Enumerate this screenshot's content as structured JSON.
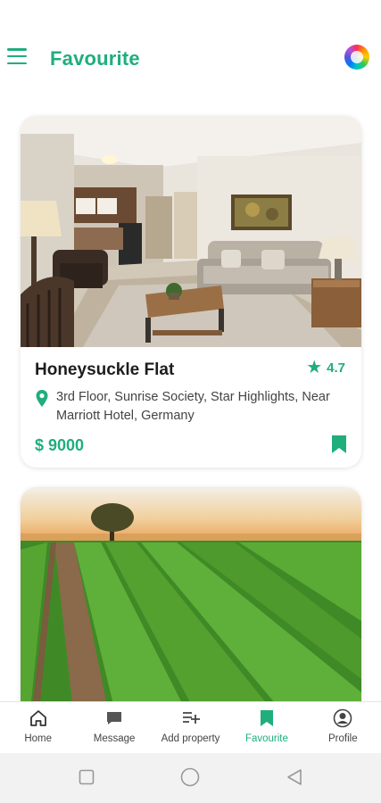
{
  "header": {
    "title": "Favourite"
  },
  "properties": [
    {
      "name": "Honeysuckle Flat",
      "rating": "4.7",
      "address": "3rd Floor, Sunrise Society, Star Highlights, Near Marriott Hotel, Germany",
      "price": "$ 9000",
      "image": "living-room-photo"
    },
    {
      "image": "farm-field-photo"
    }
  ],
  "bottom_nav": {
    "items": [
      {
        "label": "Home",
        "icon": "home-icon"
      },
      {
        "label": "Message",
        "icon": "message-icon"
      },
      {
        "label": "Add property",
        "icon": "add-property-icon"
      },
      {
        "label": "Favourite",
        "icon": "bookmark-icon",
        "active": true
      },
      {
        "label": "Profile",
        "icon": "profile-icon"
      }
    ]
  },
  "colors": {
    "accent": "#1fae7c",
    "text": "#1d1d1d",
    "muted": "#444444"
  }
}
